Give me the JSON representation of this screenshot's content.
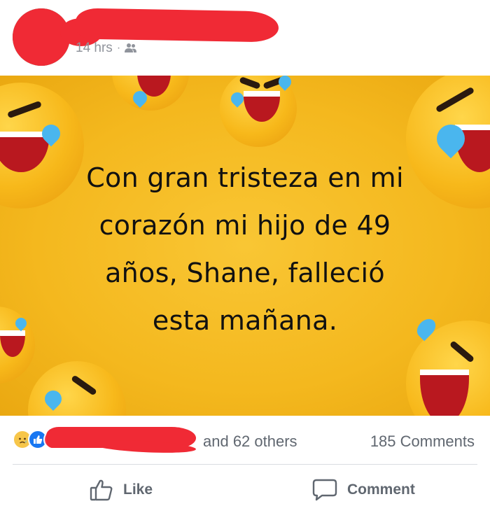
{
  "post": {
    "time": "14 hrs",
    "separator": "·",
    "audience_icon": "friends-icon",
    "image_text_lines": [
      "Con gran tristeza en mi",
      "corazón mi hijo de 49",
      "años, Shane, falleció",
      "esta mañana."
    ]
  },
  "reactions": {
    "icons": [
      "sad-reaction-icon",
      "like-reaction-icon",
      "love-reaction-icon"
    ],
    "others_text": "and 62 others",
    "comments_text": "185 Comments"
  },
  "actions": {
    "like_label": "Like",
    "comment_label": "Comment"
  },
  "colors": {
    "background_yellow": "#f4b81e",
    "facebook_blue": "#1877f2",
    "love_red": "#f33e58",
    "redaction_red": "#f02a35",
    "meta_gray": "#606770"
  }
}
